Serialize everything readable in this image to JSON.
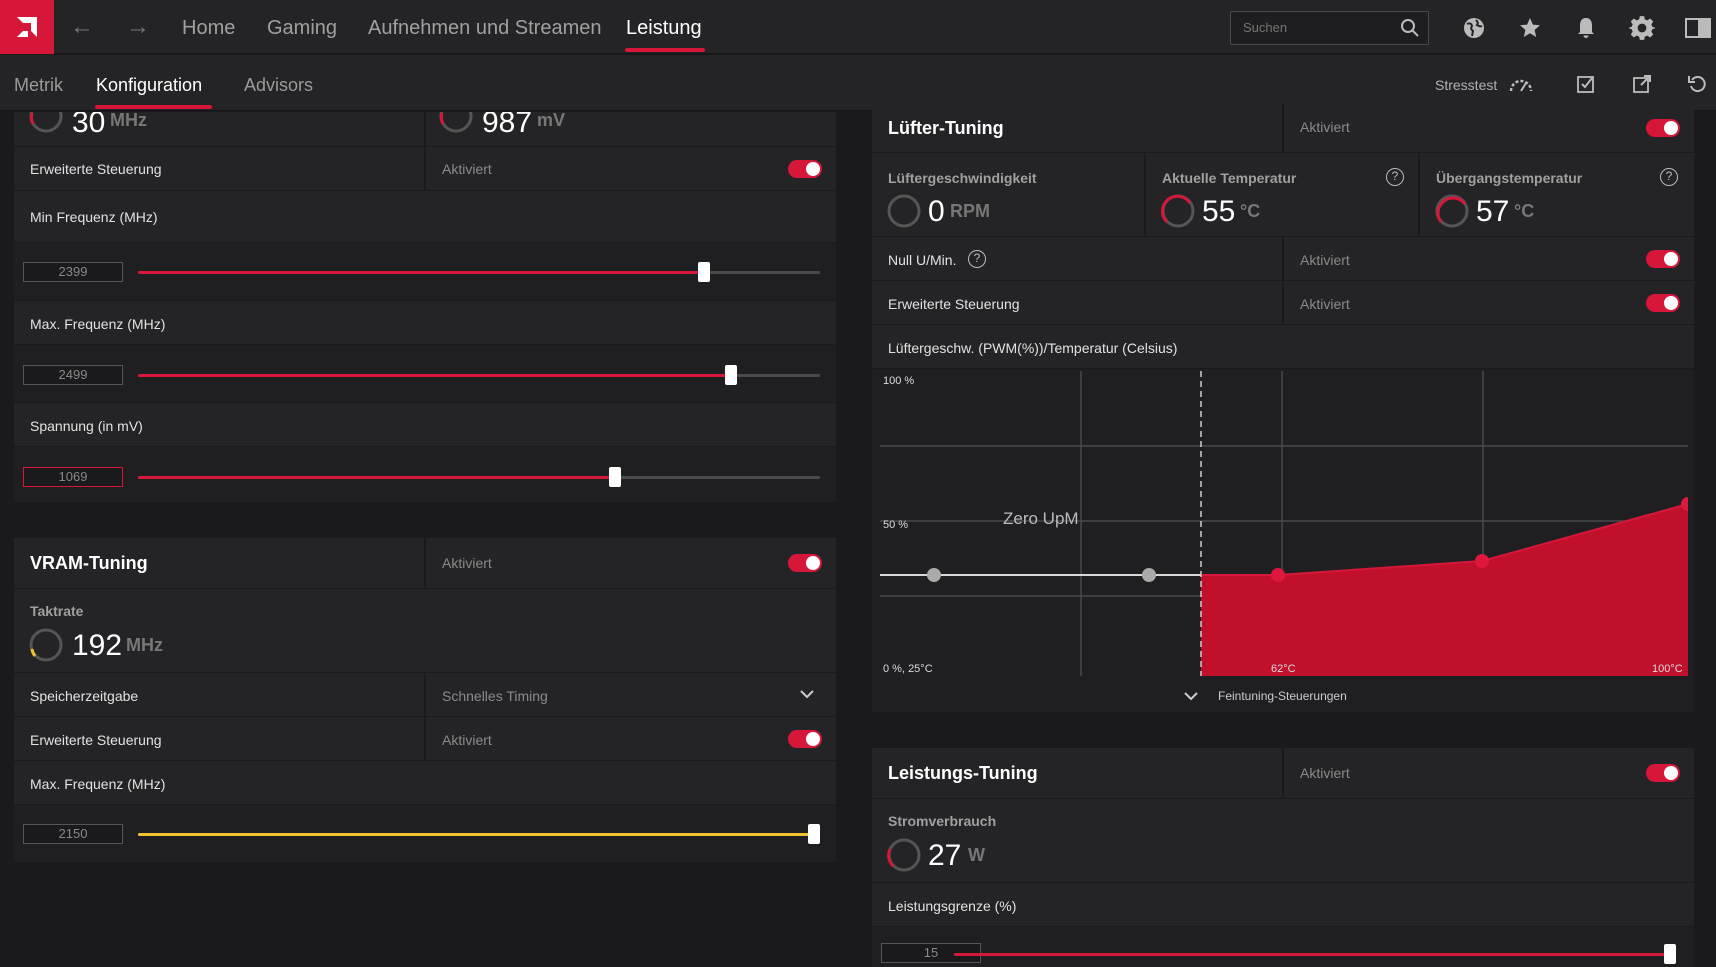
{
  "topbar": {
    "nav": [
      "Home",
      "Gaming",
      "Aufnehmen und Streamen",
      "Leistung"
    ],
    "search_placeholder": "Suchen"
  },
  "subbar": {
    "tabs": [
      "Metrik",
      "Konfiguration",
      "Advisors"
    ],
    "stresstest_label": "Stresstest"
  },
  "gpu_tuning": {
    "top_clock_value": "30",
    "top_clock_unit": "MHz",
    "top_voltage_value": "987",
    "top_voltage_unit": "mV",
    "advanced_label": "Erweiterte Steuerung",
    "advanced_status": "Aktiviert",
    "min_freq_label": "Min Frequenz (MHz)",
    "min_freq_value": "2399",
    "min_freq_fraction": 0.83,
    "max_freq_label": "Max. Frequenz (MHz)",
    "max_freq_value": "2499",
    "max_freq_fraction": 0.87,
    "voltage_label": "Spannung (in mV)",
    "voltage_value": "1069",
    "voltage_fraction": 0.7
  },
  "vram_tuning": {
    "title": "VRAM-Tuning",
    "status": "Aktiviert",
    "clock_label": "Taktrate",
    "clock_value": "192",
    "clock_unit": "MHz",
    "timing_label": "Speicherzeitgabe",
    "timing_value": "Schnelles Timing",
    "advanced_label": "Erweiterte Steuerung",
    "advanced_status": "Aktiviert",
    "max_freq_label": "Max. Frequenz (MHz)",
    "max_freq_value": "2150",
    "max_freq_fraction": 1.0
  },
  "fan_tuning": {
    "title": "Lüfter-Tuning",
    "status": "Aktiviert",
    "fan_speed_label": "Lüftergeschwindigkeit",
    "fan_speed_value": "0",
    "fan_speed_unit": "RPM",
    "temp_label": "Aktuelle Temperatur",
    "temp_value": "55",
    "temp_unit": "°C",
    "junction_label": "Übergangstemperatur",
    "junction_value": "57",
    "junction_unit": "°C",
    "zero_rpm_label": "Null U/Min.",
    "zero_rpm_status": "Aktiviert",
    "advanced_label": "Erweiterte Steuerung",
    "advanced_status": "Aktiviert",
    "curve_label": "Lüftergeschw. (PWM(%))/Temperatur (Celsius)",
    "chart_y_top": "100 %",
    "chart_y_mid": "50 %",
    "chart_origin": "0 %, 25°C",
    "chart_x_mid": "62°C",
    "chart_x_max": "100°C",
    "zero_upm_label": "Zero UpM",
    "fine_tuning_label": "Feintuning-Steuerungen"
  },
  "power_tuning": {
    "title": "Leistungs-Tuning",
    "status": "Aktiviert",
    "power_label": "Stromverbrauch",
    "power_value": "27",
    "power_unit": "W",
    "limit_label": "Leistungsgrenze (%)",
    "limit_value": "15",
    "limit_fraction": 1.0
  },
  "colors": {
    "accent": "#d6173a",
    "yellow": "#f2c12e",
    "panel": "#242427",
    "background": "#1a1a1c"
  }
}
